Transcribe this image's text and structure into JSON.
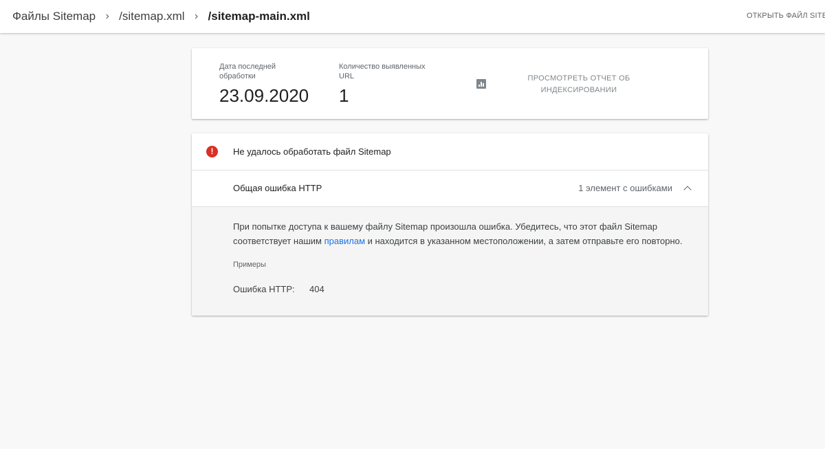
{
  "header": {
    "breadcrumb": [
      "Файлы Sitemap",
      "/sitemap.xml",
      "/sitemap-main.xml"
    ],
    "open_file_label": "ОТКРЫТЬ ФАЙЛ SITE"
  },
  "stats": {
    "last_processed_label": "Дата последней обработки",
    "last_processed_value": "23.09.2020",
    "discovered_urls_label": "Количество выявленных URL",
    "discovered_urls_value": "1",
    "report_icon": "bar-chart-icon",
    "report_link_label": "ПРОСМОТРЕТЬ ОТЧЕТ ОБ ИНДЕКСИРОВАНИИ"
  },
  "status": {
    "icon": "error-icon",
    "icon_glyph": "!",
    "message": "Не удалось обработать файл Sitemap",
    "issue_title": "Общая ошибка HTTP",
    "issue_count": "1 элемент с ошибками",
    "description_before_link": "При попытке доступа к вашему файлу Sitemap произошла ошибка. Убедитесь, что этот файл Sitemap соответствует нашим ",
    "description_link": "правилам",
    "description_after_link": " и находится в указанном местоположении, а затем отправьте его повторно.",
    "examples_label": "Примеры",
    "example_key": "Ошибка HTTP:",
    "example_value": "404"
  },
  "colors": {
    "error": "#d93025",
    "link": "#1a73e8",
    "background": "#f8f8f8"
  }
}
